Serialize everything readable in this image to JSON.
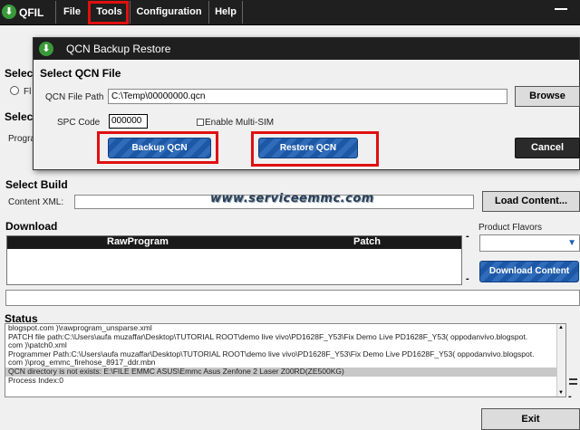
{
  "app": {
    "logo_glyph": "⬇",
    "title": "QFIL"
  },
  "menu": [
    "File",
    "Tools",
    "Configuration",
    "Help"
  ],
  "main": {
    "select_label_1": "Selec",
    "radio_fragment": "Fl",
    "select_label_2": "Selec",
    "programmer_fragment": "Program",
    "select_build": "Select Build",
    "content_xml_label": "Content XML:",
    "load_content": "Load Content...",
    "download_title": "Download",
    "product_flavors": "Product Flavors",
    "table_headers": [
      "RawProgram",
      "Patch"
    ],
    "download_content": "Download Content",
    "status_title": "Status",
    "status_lines": [
      "blogspot.com )\\rawprogram_unsparse.xml",
      "PATCH file path:C:\\Users\\aufa muzaffar\\Desktop\\TUTORIAL ROOT\\demo live vivo\\PD1628F_Y53\\Fix Demo Live PD1628F_Y53( oppodanvivo.blogspot.",
      "com )\\patch0.xml",
      "Programmer Path:C:\\Users\\aufa muzaffar\\Desktop\\TUTORIAL ROOT\\demo live vivo\\PD1628F_Y53\\Fix Demo Live PD1628F_Y53( oppodanvivo.blogspot.",
      "com )\\prog_emmc_firehose_8917_ddr.mbn",
      "QCN directory is not exists: E:\\FILE EMMC ASUS\\Emmc Asus Zenfone 2 Laser Z00RD(ZE500KG)",
      "Process Index:0"
    ],
    "exit": "Exit",
    "watermark": "www.serviceemmc.com",
    "dash": "-"
  },
  "dialog": {
    "title": "QCN Backup Restore",
    "section": "Select QCN File",
    "qcn_path_label": "QCN File Path",
    "qcn_path_value": "C:\\Temp\\00000000.qcn",
    "browse": "Browse",
    "spc_label": "SPC Code",
    "spc_value": "000000",
    "multisim_label": "Enable Multi-SIM",
    "backup": "Backup QCN",
    "restore": "Restore QCN",
    "cancel": "Cancel"
  },
  "colors": {
    "highlight": "#e01010",
    "accent_blue": "#1e5fb3",
    "titlebar": "#1f1f1f"
  }
}
